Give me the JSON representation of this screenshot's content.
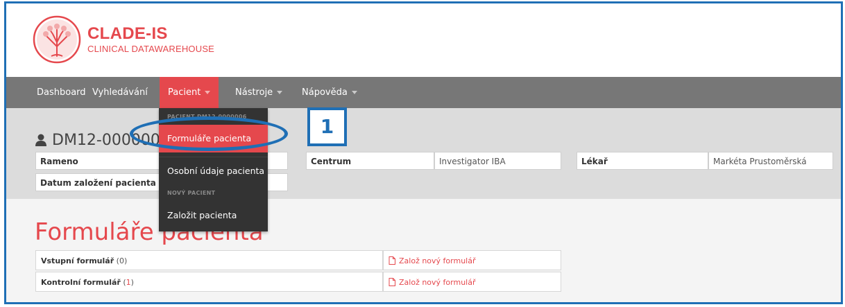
{
  "app": {
    "name": "CLADE-IS",
    "subtitle": "CLINICAL DATAWAREHOUSE"
  },
  "navbar": {
    "items": [
      {
        "label": "Dashboard",
        "has_caret": false,
        "active": false
      },
      {
        "label": "Vyhledávání",
        "has_caret": false,
        "active": false
      },
      {
        "label": "Pacient",
        "has_caret": true,
        "active": true
      },
      {
        "label": "Nástroje",
        "has_caret": true,
        "active": false
      },
      {
        "label": "Nápověda",
        "has_caret": true,
        "active": false
      }
    ]
  },
  "dropdown": {
    "header_patient": "PACIENT DM12-0000006",
    "item_forms": "Formuláře pacienta",
    "item_personal": "Osobní údaje pacienta",
    "header_new": "NOVÝ PACIENT",
    "item_create": "Založit pacienta"
  },
  "patient": {
    "id": "DM12-0000006",
    "fields": {
      "rameno_label": "Rameno",
      "rameno_value": "",
      "datum_label": "Datum založení pacienta",
      "datum_value": "",
      "centrum_label": "Centrum",
      "centrum_value": "Investigator IBA",
      "lekar_label": "Lékař",
      "lekar_value": "Markéta Prustoměrská"
    }
  },
  "forms": {
    "heading": "Formuláře pacienta",
    "rows": [
      {
        "name": "Vstupní formulář",
        "count": "(0)",
        "count_num": "0",
        "action": "Založ nový formulář"
      },
      {
        "name": "Kontrolní formulář",
        "count": "(1)",
        "count_num": "1",
        "action": "Založ nový formulář"
      }
    ]
  },
  "annotation": {
    "step": "1",
    "color": "#1f6fb5"
  },
  "colors": {
    "accent": "#e5484d",
    "navbar": "#777777",
    "dropdown": "#333333",
    "band": "#dcdcdc"
  },
  "icons": {
    "patient": "user-icon",
    "form_action": "document-icon",
    "logo": "tree-logo-icon"
  }
}
